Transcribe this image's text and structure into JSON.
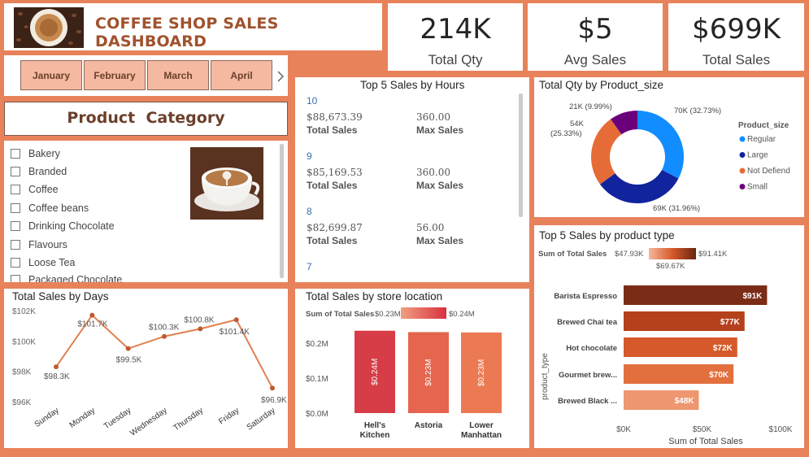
{
  "header": {
    "title": "COFFEE SHOP SALES DASHBOARD",
    "logo_icon": "coffee-cup-icon"
  },
  "kpis": [
    {
      "value": "214K",
      "label": "Total Qty"
    },
    {
      "value": "$5",
      "label": "Avg Sales"
    },
    {
      "value": "$699K",
      "label": "Total Sales"
    }
  ],
  "months": {
    "items": [
      "January",
      "February",
      "March",
      "April"
    ],
    "next_icon": "chevron-right-icon"
  },
  "category": {
    "title": "Product  Category",
    "items": [
      "Bakery",
      "Branded",
      "Coffee",
      "Coffee beans",
      "Drinking Chocolate",
      "Flavours",
      "Loose Tea",
      "Packaged Chocolate"
    ],
    "image_icon": "latte-art-cup-icon"
  },
  "top5_hours": {
    "title": "Top 5 Sales by Hours",
    "rows": [
      {
        "hour": "10",
        "sales": "$88,673.39",
        "sales_label": "Total Sales",
        "max": "360.00",
        "max_label": "Max Sales"
      },
      {
        "hour": "9",
        "sales": "$85,169.53",
        "sales_label": "Total Sales",
        "max": "360.00",
        "max_label": "Max Sales"
      },
      {
        "hour": "8",
        "sales": "$82,699.87",
        "sales_label": "Total Sales",
        "max": "56.00",
        "max_label": "Max Sales"
      },
      {
        "hour": "7",
        "sales": "",
        "sales_label": "",
        "max": "",
        "max_label": ""
      }
    ]
  },
  "colors": {
    "background": "#E8825A",
    "title": "#A0522D",
    "line": "#E0804F",
    "donut": [
      "#118DFF",
      "#12239E",
      "#E66C37",
      "#6B007B"
    ],
    "product_bars": [
      "#7B2C16",
      "#B5401C",
      "#D5592A",
      "#E2703E",
      "#EE9670"
    ],
    "store_bars": [
      "#D63D47",
      "#E5654E",
      "#EB7A52"
    ]
  },
  "chart_data": [
    {
      "type": "line",
      "title": "Total Sales by Days",
      "categories": [
        "Sunday",
        "Monday",
        "Tuesday",
        "Wednesday",
        "Thursday",
        "Friday",
        "Saturday"
      ],
      "values": [
        98.3,
        101.7,
        99.5,
        100.3,
        100.8,
        101.4,
        96.9
      ],
      "labels": [
        "$98.3K",
        "$101.7K",
        "$99.5K",
        "$100.3K",
        "$100.8K",
        "$101.4K",
        "$96.9K"
      ],
      "ylim": [
        96,
        102
      ],
      "yticks": [
        "$96K",
        "$98K",
        "$100K",
        "$102K"
      ],
      "ytick_values": [
        96,
        98,
        100,
        102
      ],
      "grid": false
    },
    {
      "type": "bar",
      "title": "Total Sales by store location",
      "legend_title": "Sum of Total Sales",
      "legend_min": "$0.23M",
      "legend_max": "$0.24M",
      "categories": [
        "Hell's Kitchen",
        "Astoria",
        "Lower Manhattan"
      ],
      "values": [
        0.236,
        0.232,
        0.231
      ],
      "labels": [
        "$0.24M",
        "$0.23M",
        "$0.23M"
      ],
      "ylim": [
        0,
        0.24
      ],
      "yticks": [
        "$0.0M",
        "$0.1M",
        "$0.2M"
      ],
      "ytick_values": [
        0,
        0.1,
        0.2
      ]
    },
    {
      "type": "pie",
      "title": "Total Qty by Product_size",
      "legend_title": "Product_size",
      "legend_placement": "right",
      "slices": [
        {
          "name": "Regular",
          "value": 70,
          "label": "70K (32.73%)"
        },
        {
          "name": "Large",
          "value": 69,
          "label": "69K (31.96%)"
        },
        {
          "name": "Not Defiend",
          "value": 54,
          "label": "54K (25.33%)"
        },
        {
          "name": "Small",
          "value": 21,
          "label": "21K (9.99%)"
        }
      ]
    },
    {
      "type": "bar",
      "orientation": "horizontal",
      "title": "Top 5 Sales by product type",
      "legend_title": "Sum of Total Sales",
      "legend_min": "$47.93K",
      "legend_mid": "$69.67K",
      "legend_max": "$91.41K",
      "categories": [
        "Barista Espresso",
        "Brewed Chai tea",
        "Hot chocolate",
        "Gourmet brew...",
        "Brewed Black ..."
      ],
      "values": [
        91.41,
        77.08,
        72.42,
        70.03,
        47.93
      ],
      "labels": [
        "$91K",
        "$77K",
        "$72K",
        "$70K",
        "$48K"
      ],
      "xlabel": "Sum of Total Sales",
      "ylabel": "product_type",
      "xlim": [
        0,
        100
      ],
      "xticks": [
        "$0K",
        "$50K",
        "$100K"
      ],
      "xtick_values": [
        0,
        50,
        100
      ]
    }
  ]
}
